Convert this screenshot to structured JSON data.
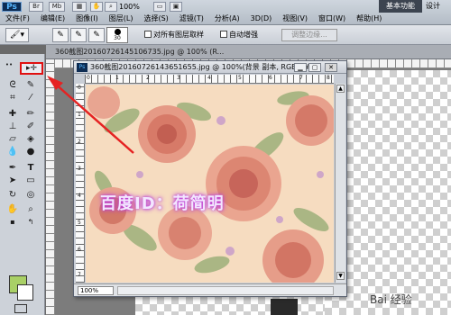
{
  "app": {
    "logo": "Ps",
    "top_buttons": [
      "Br",
      "Mb"
    ],
    "zoom": "100%",
    "workspace_label": "基本功能",
    "design_label": "设计"
  },
  "menu": {
    "items": [
      "文件(F)",
      "编辑(E)",
      "图像(I)",
      "图层(L)",
      "选择(S)",
      "滤镜(T)",
      "分析(A)",
      "3D(D)",
      "视图(V)",
      "窗口(W)",
      "帮助(H)"
    ]
  },
  "options_bar": {
    "brush_size": "30",
    "sample_all_layers_label": "对所有图层取样",
    "auto_enhance_label": "自动增强",
    "refine_edge_label": "调整边缘..."
  },
  "background_tab": {
    "title": "360截图20160726145106735.jpg @ 100% (R..."
  },
  "document_window": {
    "title": "360截图20160726143651655.jpg @ 100%(背景 副本, RGB/8#)",
    "zoom": "100%",
    "ruler_h": [
      "0",
      "1",
      "2",
      "3",
      "4",
      "5",
      "6",
      "7",
      "8"
    ],
    "ruler_v": [
      "0",
      "1",
      "2",
      "3",
      "4",
      "5",
      "6",
      "7"
    ],
    "watermark": "百度ID：荷简明"
  },
  "toolbox": {
    "foreground_color": "#a9d066",
    "background_color": "#ffffff"
  },
  "site_watermark": "Bai 经验"
}
